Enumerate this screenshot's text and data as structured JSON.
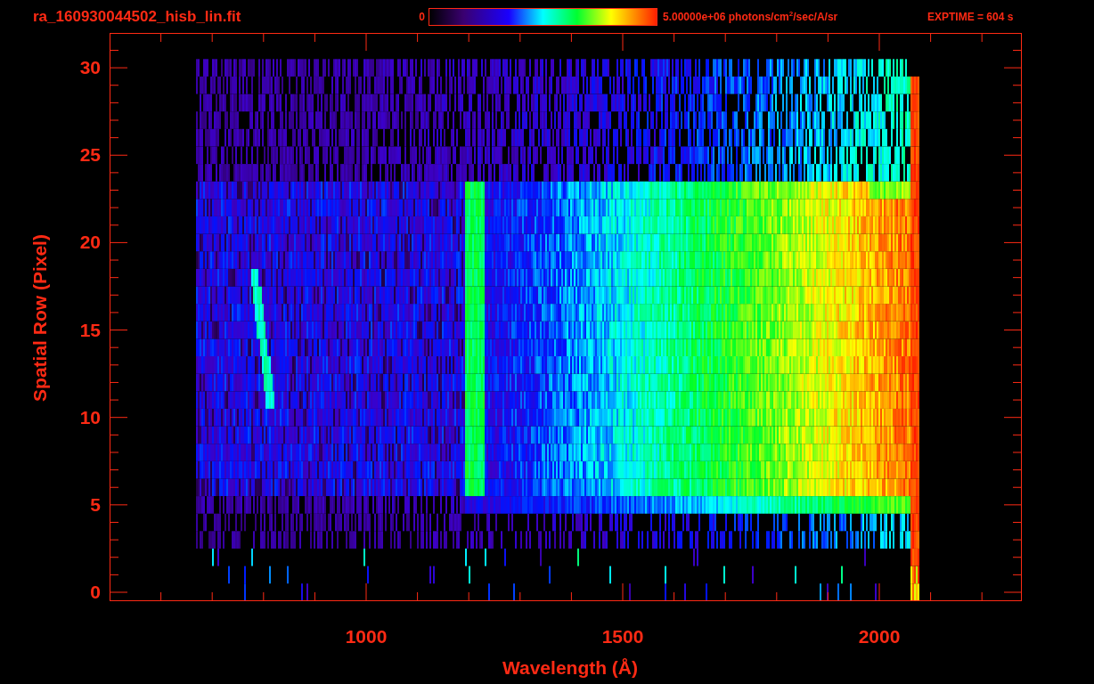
{
  "header": {
    "title": "ra_160930044502_hisb_lin.fit",
    "colorbar_min": "0",
    "colorbar_max": "5.00000e+06 photons/cm$^{2}$/sec/A/sr",
    "exposure": "EXPTIME = 604 s"
  },
  "plot": {
    "ylabel": "Spatial Row (Pixel)",
    "xlabel": "Wavelength (Å)",
    "yticks": [
      "30",
      "25",
      "20",
      "15",
      "10",
      "5",
      "0"
    ],
    "xticks": [
      "1000",
      "1500",
      "2000"
    ]
  }
}
